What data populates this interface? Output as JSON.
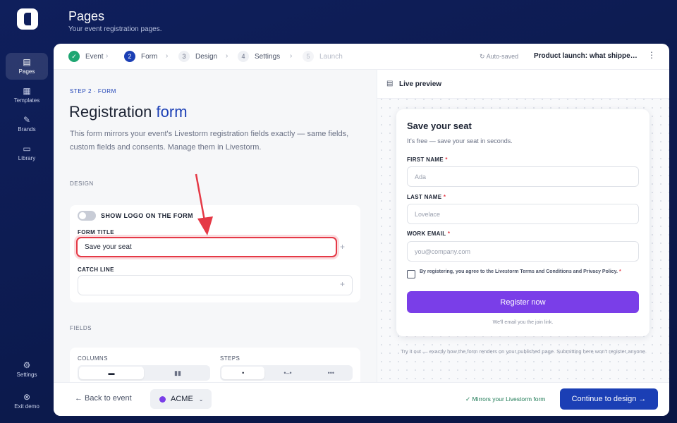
{
  "rail": {
    "items": [
      {
        "label": "Pages",
        "icon": "pages-icon"
      },
      {
        "label": "Templates",
        "icon": "grid-icon"
      },
      {
        "label": "Brands",
        "icon": "brush-icon"
      },
      {
        "label": "Library",
        "icon": "tv-icon"
      },
      {
        "label": "Settings",
        "icon": "gear-icon"
      },
      {
        "label": "Exit demo",
        "icon": "exit-icon"
      }
    ]
  },
  "header": {
    "title": "Pages",
    "subtitle": "Your event registration pages."
  },
  "steps": [
    {
      "num": "✓",
      "label": "Event"
    },
    {
      "num": "2",
      "label": "Form"
    },
    {
      "num": "3",
      "label": "Design"
    },
    {
      "num": "4",
      "label": "Settings"
    },
    {
      "num": "5",
      "label": "Launch"
    }
  ],
  "topbar": {
    "autosave": "Auto-saved",
    "event_name": "Product launch: what shipped t...",
    "more": "⋮"
  },
  "main": {
    "eyebrow": "STEP 2 · FORM",
    "title_part1": "Registration",
    "title_part2": "form",
    "description": "This form mirrors your event's Livestorm registration fields exactly — same fields, custom fields and consents. Manage them in Livestorm.",
    "design_label": "DESIGN",
    "show_logo_label": "SHOW LOGO ON THE FORM",
    "form_title_label": "FORM TITLE",
    "form_title_value": "Save your seat",
    "catch_line_label": "CATCH LINE",
    "catch_line_value": "",
    "fields_label": "FIELDS",
    "columns_label": "COLUMNS",
    "steps_label": "STEPS",
    "columns_options": [
      "▬",
      "▮▮"
    ],
    "steps_options": [
      "•",
      "•–•",
      "•••"
    ]
  },
  "preview": {
    "title": "Live preview",
    "form_title": "Save your seat",
    "form_sub": "It's free — save your seat in seconds.",
    "fields": [
      {
        "label": "FIRST NAME",
        "required": "*",
        "placeholder": "Ada"
      },
      {
        "label": "LAST NAME",
        "required": "*",
        "placeholder": "Lovelace"
      },
      {
        "label": "WORK EMAIL",
        "required": "*",
        "placeholder": "you@company.com"
      }
    ],
    "consent": "By registering, you agree to the Livestorm Terms and Conditions and Privacy Policy.",
    "consent_req": "*",
    "button": "Register now",
    "note": "We'll email you the join link.",
    "footnote": "Try it out — exactly how the form renders on your published page. Submitting here won't register anyone."
  },
  "footer": {
    "back": "← Back to event",
    "brand": "ACME",
    "mirror": "✓ Mirrors your Livestorm form",
    "continue": "Continue to design →"
  },
  "colors": {
    "accent": "#1b3fb5",
    "purple": "#7a3ee8",
    "success": "#1ea672",
    "alert": "#e53946"
  }
}
